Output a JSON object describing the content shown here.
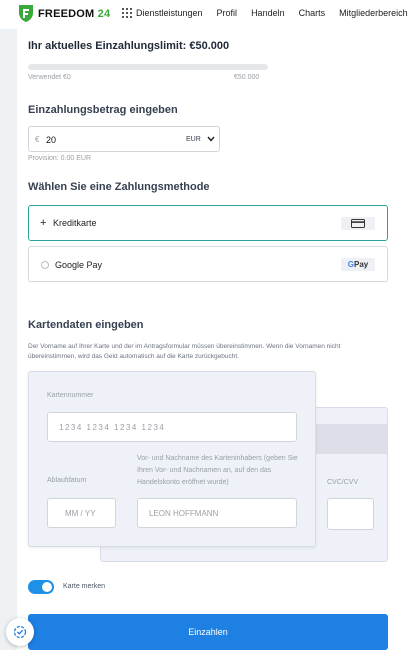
{
  "header": {
    "logo_text": "FREEDOM",
    "logo_number": "24",
    "nav": [
      "Dienstleistungen",
      "Profil",
      "Handeln",
      "Charts",
      "Mitgliederbereich"
    ]
  },
  "limit": {
    "title": "Ihr aktuelles Einzahlungslimit: €50.000",
    "used_label": "Verwendet €0",
    "max_label": "€50.000",
    "used_fraction": 0
  },
  "amount": {
    "heading": "Einzahlungsbetrag eingeben",
    "currency_symbol": "€",
    "value": "20",
    "currency": "EUR",
    "provision": "Provision: 0.00 EUR"
  },
  "payment": {
    "heading": "Wählen Sie eine Zahlungsmethode",
    "methods": [
      {
        "label": "Kreditkarte",
        "selected": true,
        "icon": "credit-card-icon"
      },
      {
        "label": "Google Pay",
        "selected": false,
        "icon": "google-pay-icon",
        "badge_text": "Pay",
        "badge_g": "G"
      }
    ]
  },
  "card": {
    "heading": "Kartendaten eingeben",
    "note": "Der Vorname auf Ihrer Karte und der im Antragsformular müssen übereinstimmen. Wenn die Vornamen nicht übereinstimmen, wird das Geld automatisch auf die Karte zurückgebucht.",
    "number_label": "Kartennummer",
    "number_placeholder": "1234 1234 1234 1234",
    "expiry_label": "Ablaufdatum",
    "expiry_placeholder": "MM / YY",
    "holder_label": "Vor- und Nachname des Karteninhabers (geben Sie Ihren Vor- und Nachnamen an, auf den das Handelskonto eröffnet wurde)",
    "holder_value": "LEON HOFFMANN",
    "cvc_label": "CVC/CVV"
  },
  "remember": {
    "label": "Karte merken",
    "on": true
  },
  "submit_label": "Einzahlen",
  "colors": {
    "accent": "#1d80e2",
    "selected_border": "#2aa39a",
    "brand_green": "#3aa83a"
  }
}
